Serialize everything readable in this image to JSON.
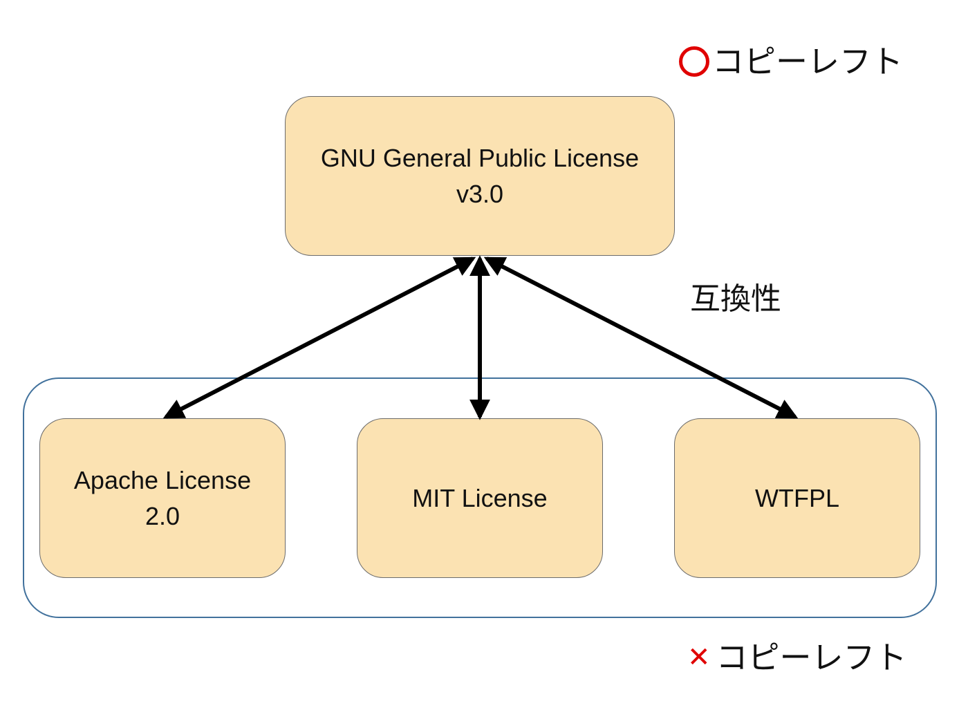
{
  "legend": {
    "copyleft_text": "コピーレフト",
    "non_copyleft_text": "コピーレフト",
    "copyleft_mark_color": "#e00000",
    "non_copyleft_mark": "✕"
  },
  "compatibility_label": "互換性",
  "top_box": {
    "text": "GNU General Public License\nv3.0"
  },
  "bottom_boxes": [
    {
      "text": "Apache License\n2.0"
    },
    {
      "text": "MIT License"
    },
    {
      "text": "WTFPL"
    }
  ],
  "colors": {
    "box_fill": "#fbe2b2",
    "group_border": "#41719c",
    "arrow": "#000000"
  }
}
